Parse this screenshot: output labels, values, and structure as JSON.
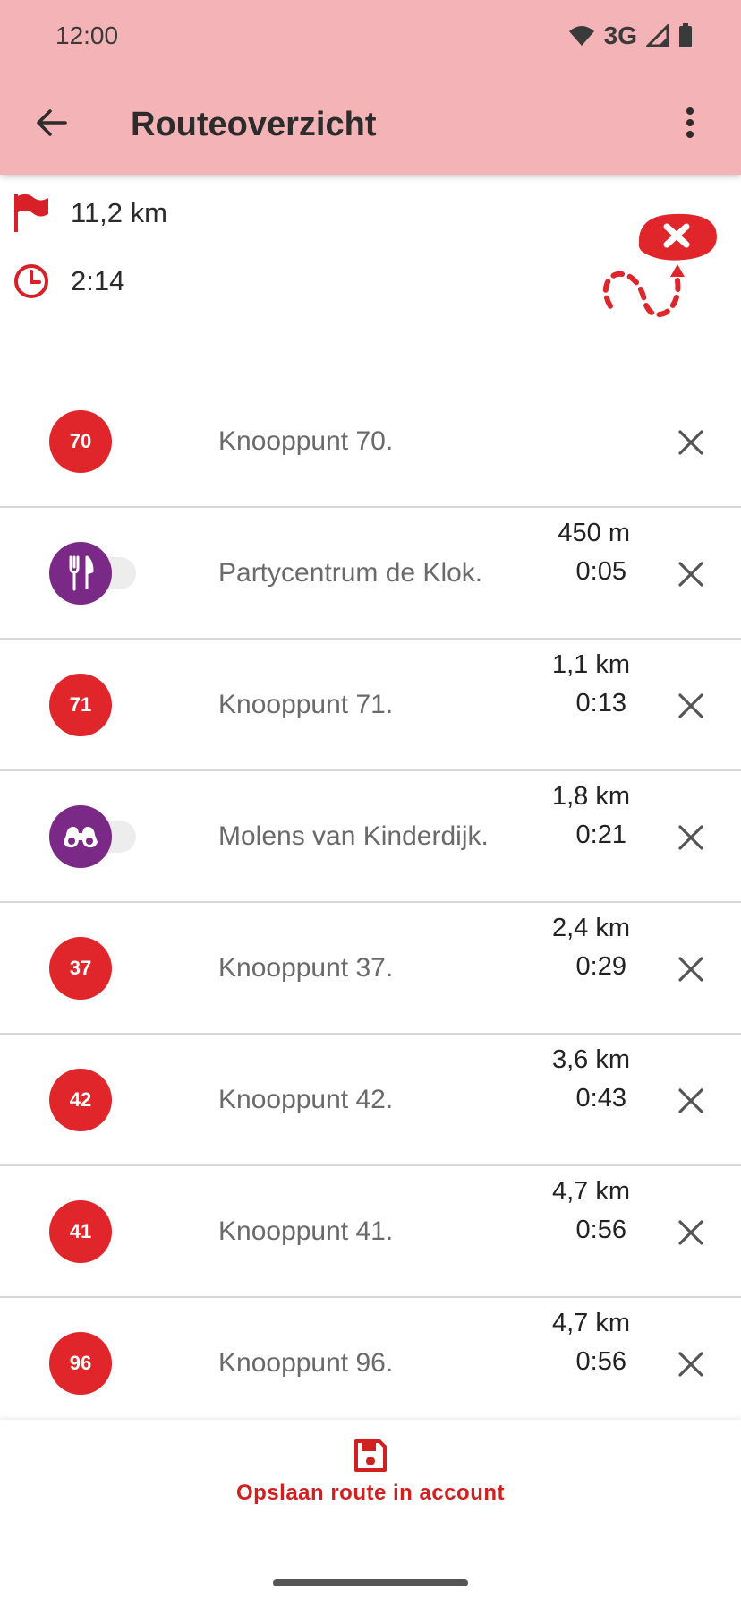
{
  "status_bar": {
    "time": "12:00",
    "network": "3G"
  },
  "app_bar": {
    "title": "Routeoverzicht"
  },
  "summary": {
    "distance": "11,2 km",
    "duration": "2:14"
  },
  "colors": {
    "app_bar": "#f4b4b7",
    "accent_red": "#e0262b",
    "poi_purple": "#7a2a86",
    "save_red": "#d0201f"
  },
  "rows": [
    {
      "type": "knooppunt",
      "badge": "70",
      "label": "Knooppunt 70.",
      "distance": "",
      "time": ""
    },
    {
      "type": "poi",
      "icon": "restaurant-icon",
      "label": "Partycentrum de Klok.",
      "distance": "450 m",
      "time": "0:05"
    },
    {
      "type": "knooppunt",
      "badge": "71",
      "label": "Knooppunt 71.",
      "distance": "1,1 km",
      "time": "0:13"
    },
    {
      "type": "poi",
      "icon": "binoculars-icon",
      "label": "Molens van Kinderdijk.",
      "distance": "1,8 km",
      "time": "0:21"
    },
    {
      "type": "knooppunt",
      "badge": "37",
      "label": "Knooppunt 37.",
      "distance": "2,4 km",
      "time": "0:29"
    },
    {
      "type": "knooppunt",
      "badge": "42",
      "label": "Knooppunt 42.",
      "distance": "3,6 km",
      "time": "0:43"
    },
    {
      "type": "knooppunt",
      "badge": "41",
      "label": "Knooppunt 41.",
      "distance": "4,7 km",
      "time": "0:56"
    },
    {
      "type": "knooppunt",
      "badge": "96",
      "label": "Knooppunt 96.",
      "distance": "4,7 km",
      "time": "0:56"
    }
  ],
  "save": {
    "label": "Opslaan route in account"
  }
}
